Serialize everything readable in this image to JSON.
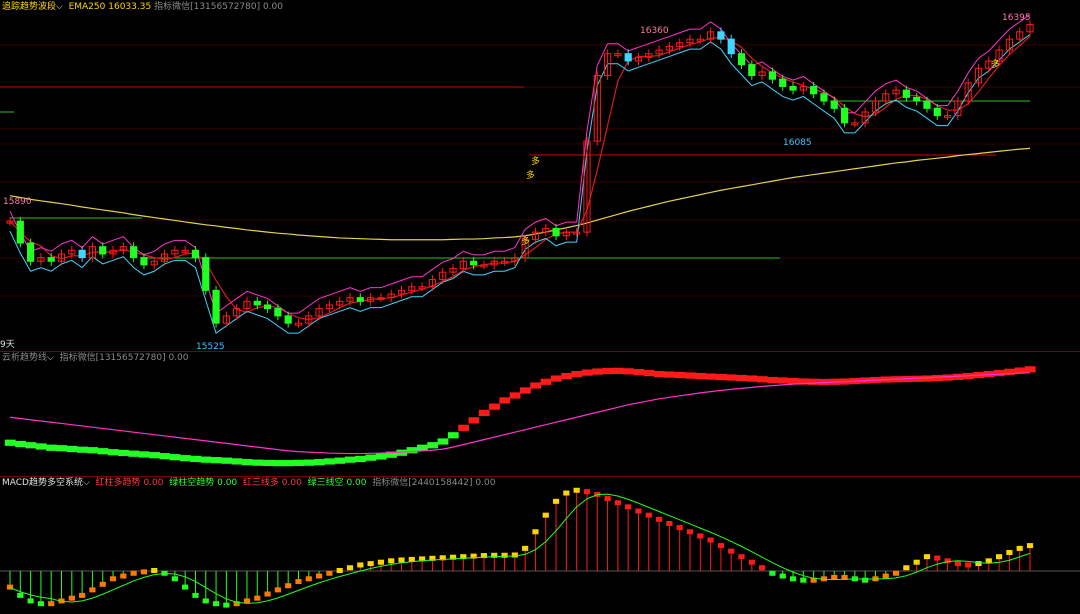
{
  "panels": {
    "main": {
      "title": "追踪趋势波段",
      "ema_label": "EMA250",
      "ema_value": "16033.35",
      "extra_label": "指标微信[13156572780]",
      "extra_value": "0.00"
    },
    "cloud": {
      "title": "云析趋势线",
      "extra_label": "指标微信[13156572780]",
      "extra_value": "0.00"
    },
    "macd": {
      "title": "MACD趋势多空系统",
      "items": [
        {
          "label": "红柱多趋势",
          "value": "0.00"
        },
        {
          "label": "绿柱空趋势",
          "value": "0.00"
        },
        {
          "label": "红三线多",
          "value": "0.00"
        },
        {
          "label": "绿三线空",
          "value": "0.00"
        },
        {
          "label": "指标微信[2440158442]",
          "value": "0.00"
        }
      ]
    }
  },
  "day_label": "9天",
  "colors": {
    "up": "#ff1a1a",
    "down": "#22ff22",
    "cyan": "#3fd6ff",
    "ema": "#e6d14a",
    "magenta": "#ff33cc",
    "level_red": "#d40000",
    "level_green": "#27c227"
  },
  "chart_data": {
    "type": "candlestick",
    "series_count": 100,
    "price_range": [
      15500,
      16420
    ],
    "labels": {
      "high_left": "15890",
      "low_left": "15525",
      "high_mid": "16360",
      "low_right": "16085",
      "high_right": "16395"
    },
    "signals": [
      "多",
      "多",
      "多",
      "多"
    ],
    "closes": [
      15840,
      15780,
      15730,
      15740,
      15730,
      15750,
      15760,
      15740,
      15770,
      15750,
      15760,
      15770,
      15740,
      15720,
      15730,
      15750,
      15760,
      15760,
      15740,
      15650,
      15560,
      15580,
      15600,
      15620,
      15610,
      15600,
      15580,
      15560,
      15560,
      15580,
      15600,
      15610,
      15620,
      15630,
      15620,
      15630,
      15630,
      15640,
      15650,
      15660,
      15660,
      15680,
      15700,
      15710,
      15730,
      15720,
      15720,
      15730,
      15730,
      15740,
      15790,
      15810,
      15820,
      15800,
      15810,
      15810,
      16060,
      16240,
      16300,
      16300,
      16280,
      16290,
      16300,
      16310,
      16320,
      16330,
      16340,
      16340,
      16360,
      16340,
      16300,
      16270,
      16240,
      16250,
      16230,
      16210,
      16200,
      16210,
      16190,
      16170,
      16150,
      16110,
      16110,
      16140,
      16170,
      16190,
      16200,
      16180,
      16170,
      16150,
      16130,
      16130,
      16170,
      16220,
      16260,
      16280,
      16310,
      16340,
      16360,
      16380
    ],
    "ema250": [
      15910,
      15905,
      15900,
      15896,
      15892,
      15888,
      15884,
      15879,
      15875,
      15871,
      15867,
      15863,
      15858,
      15854,
      15850,
      15846,
      15842,
      15838,
      15834,
      15830,
      15827,
      15823,
      15820,
      15816,
      15813,
      15810,
      15807,
      15805,
      15802,
      15800,
      15798,
      15796,
      15794,
      15793,
      15792,
      15791,
      15790,
      15789,
      15789,
      15789,
      15789,
      15789,
      15789,
      15790,
      15791,
      15791,
      15792,
      15794,
      15795,
      15797,
      15800,
      15805,
      15810,
      15816,
      15822,
      15828,
      15835,
      15843,
      15851,
      15859,
      15867,
      15874,
      15881,
      15888,
      15895,
      15901,
      15907,
      15913,
      15919,
      15925,
      15930,
      15935,
      15940,
      15945,
      15950,
      15955,
      15960,
      15964,
      15968,
      15972,
      15976,
      15980,
      15984,
      15988,
      15992,
      15996,
      16000,
      16003,
      16007,
      16010,
      16013,
      16016,
      16020,
      16023,
      16026,
      16029,
      16032,
      16035,
      16038,
      16040
    ],
    "cloud_fast": [
      -0.9,
      -0.95,
      -1.0,
      -1.05,
      -1.1,
      -1.12,
      -1.15,
      -1.18,
      -1.2,
      -1.24,
      -1.28,
      -1.31,
      -1.34,
      -1.37,
      -1.4,
      -1.44,
      -1.48,
      -1.52,
      -1.55,
      -1.58,
      -1.6,
      -1.62,
      -1.65,
      -1.68,
      -1.7,
      -1.71,
      -1.72,
      -1.72,
      -1.71,
      -1.7,
      -1.68,
      -1.65,
      -1.62,
      -1.58,
      -1.55,
      -1.5,
      -1.45,
      -1.38,
      -1.3,
      -1.2,
      -1.1,
      -1.0,
      -0.85,
      -0.6,
      -0.3,
      0.0,
      0.3,
      0.55,
      0.8,
      1.0,
      1.2,
      1.4,
      1.55,
      1.68,
      1.78,
      1.86,
      1.92,
      1.96,
      1.98,
      1.99,
      1.97,
      1.94,
      1.9,
      1.86,
      1.84,
      1.82,
      1.8,
      1.78,
      1.76,
      1.74,
      1.72,
      1.7,
      1.68,
      1.65,
      1.62,
      1.6,
      1.58,
      1.56,
      1.55,
      1.54,
      1.55,
      1.56,
      1.58,
      1.6,
      1.62,
      1.64,
      1.65,
      1.66,
      1.67,
      1.68,
      1.7,
      1.72,
      1.75,
      1.78,
      1.82,
      1.86,
      1.9,
      1.95,
      2.0,
      2.05
    ],
    "cloud_slow": [
      0.0,
      -0.05,
      -0.1,
      -0.15,
      -0.2,
      -0.25,
      -0.3,
      -0.35,
      -0.4,
      -0.45,
      -0.5,
      -0.55,
      -0.6,
      -0.65,
      -0.7,
      -0.75,
      -0.8,
      -0.85,
      -0.9,
      -0.95,
      -1.0,
      -1.05,
      -1.1,
      -1.15,
      -1.2,
      -1.25,
      -1.3,
      -1.35,
      -1.38,
      -1.4,
      -1.42,
      -1.44,
      -1.45,
      -1.46,
      -1.46,
      -1.45,
      -1.44,
      -1.42,
      -1.4,
      -1.38,
      -1.35,
      -1.32,
      -1.28,
      -1.2,
      -1.1,
      -1.0,
      -0.9,
      -0.8,
      -0.7,
      -0.6,
      -0.5,
      -0.4,
      -0.3,
      -0.2,
      -0.1,
      0.0,
      0.1,
      0.2,
      0.3,
      0.4,
      0.5,
      0.58,
      0.66,
      0.74,
      0.8,
      0.86,
      0.92,
      0.98,
      1.03,
      1.08,
      1.12,
      1.16,
      1.2,
      1.24,
      1.27,
      1.3,
      1.33,
      1.35,
      1.37,
      1.39,
      1.41,
      1.43,
      1.45,
      1.47,
      1.49,
      1.51,
      1.53,
      1.55,
      1.57,
      1.59,
      1.61,
      1.63,
      1.65,
      1.67,
      1.69,
      1.71,
      1.73,
      1.75,
      1.77,
      1.79
    ],
    "macd": [
      -0.6,
      -0.9,
      -1.1,
      -1.2,
      -1.2,
      -1.1,
      -1.0,
      -0.9,
      -0.7,
      -0.5,
      -0.3,
      -0.2,
      -0.1,
      -0.05,
      0.0,
      -0.1,
      -0.3,
      -0.6,
      -0.9,
      -1.1,
      -1.2,
      -1.25,
      -1.2,
      -1.1,
      -1.0,
      -0.85,
      -0.7,
      -0.55,
      -0.4,
      -0.3,
      -0.2,
      -0.1,
      0.0,
      0.1,
      0.2,
      0.25,
      0.3,
      0.35,
      0.38,
      0.4,
      0.42,
      0.44,
      0.46,
      0.48,
      0.5,
      0.52,
      0.54,
      0.55,
      0.55,
      0.56,
      0.8,
      1.4,
      2.0,
      2.5,
      2.8,
      2.9,
      2.85,
      2.75,
      2.6,
      2.45,
      2.3,
      2.15,
      2.0,
      1.85,
      1.7,
      1.55,
      1.4,
      1.25,
      1.1,
      0.9,
      0.7,
      0.5,
      0.3,
      0.1,
      -0.1,
      -0.2,
      -0.3,
      -0.35,
      -0.35,
      -0.3,
      -0.25,
      -0.25,
      -0.3,
      -0.35,
      -0.3,
      -0.2,
      -0.1,
      0.1,
      0.3,
      0.5,
      0.45,
      0.35,
      0.25,
      0.2,
      0.25,
      0.35,
      0.5,
      0.65,
      0.8,
      0.9
    ]
  }
}
